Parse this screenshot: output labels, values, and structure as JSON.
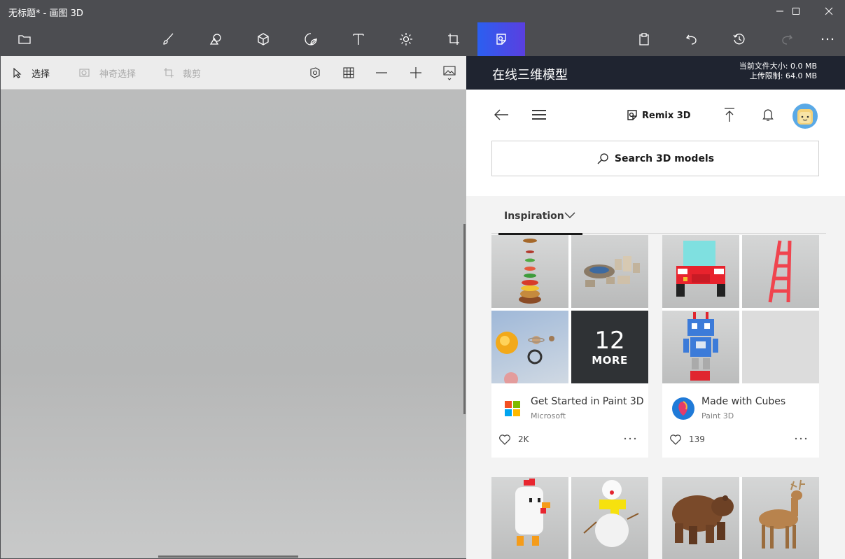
{
  "window": {
    "title": "无标题* - 画图 3D"
  },
  "left_panel": {
    "tools": {
      "select_label": "选择",
      "magic_select_label": "神奇选择",
      "crop_label": "裁剪"
    }
  },
  "right_panel": {
    "header_title": "在线三维模型",
    "file_size_label": "当前文件大小: 0.0 MB",
    "upload_limit_label": "上传限制: 64.0 MB",
    "brand_label": "Remix 3D",
    "search_placeholder": "Search 3D models",
    "tab_label": "Inspiration",
    "cards": [
      {
        "title": "Get Started in Paint 3D",
        "author": "Microsoft",
        "likes": "2K",
        "more_count": "12",
        "more_label": "MORE"
      },
      {
        "title": "Made with Cubes",
        "author": "Paint 3D",
        "likes": "139"
      }
    ]
  },
  "colors": {
    "titlebar_bg": "#4c4d51",
    "active_tool_gradient_start": "#2b5ff0",
    "active_tool_gradient_end": "#5a3fe0",
    "panel_header_bg": "#1f2430",
    "canvas_bg": "#b7b8b8"
  },
  "icons": {
    "toolbar": [
      "folder-icon",
      "brush-icon",
      "2d-shapes-icon",
      "3d-shapes-icon",
      "stickers-icon",
      "text-icon",
      "effects-icon",
      "canvas-icon",
      "remix3d-icon",
      "paste-icon",
      "undo-icon",
      "history-icon",
      "redo-icon",
      "more-icon"
    ],
    "subbar": [
      "select-icon",
      "magic-select-icon",
      "crop-icon",
      "3d-view-icon",
      "grid-icon",
      "zoom-out-icon",
      "zoom-in-icon",
      "image-view-icon"
    ]
  }
}
